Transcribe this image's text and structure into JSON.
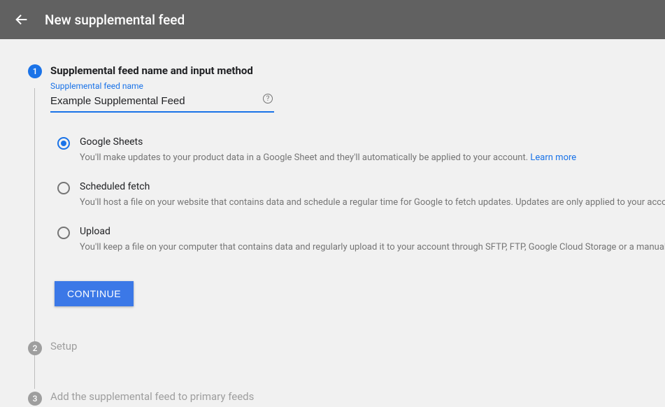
{
  "header": {
    "title": "New supplemental feed"
  },
  "step1": {
    "number": "1",
    "title": "Supplemental feed name and input method",
    "field_label": "Supplemental feed name",
    "field_value": "Example Supplemental Feed",
    "options": [
      {
        "title": "Google Sheets",
        "desc": "You'll make updates to your product data in a Google Sheet and they'll automatically be applied to your account. ",
        "learn_more": "Learn more"
      },
      {
        "title": "Scheduled fetch",
        "desc": "You'll host a file on your website that contains data and schedule a regular time for Google to fetch updates. Updates are only applied to your acco"
      },
      {
        "title": "Upload",
        "desc": "You'll keep a file on your computer that contains data and regularly upload it to your account through SFTP, FTP, Google Cloud Storage or a manual"
      }
    ],
    "continue": "CONTINUE"
  },
  "step2": {
    "number": "2",
    "title": "Setup"
  },
  "step3": {
    "number": "3",
    "title": "Add the supplemental feed to primary feeds"
  }
}
